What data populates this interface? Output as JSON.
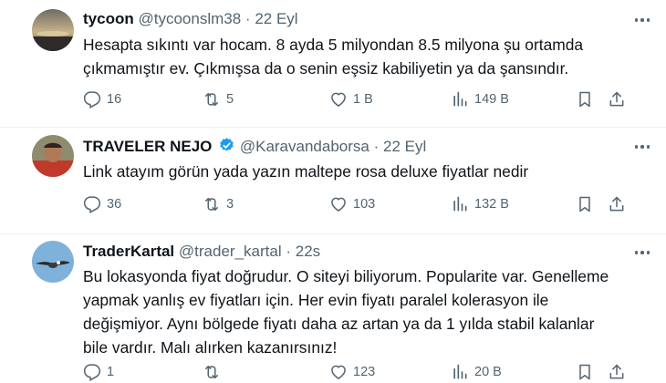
{
  "colors": {
    "text": "#0f1419",
    "muted": "#536471",
    "verified": "#1d9bf0",
    "divider": "#eff3f4"
  },
  "tweets": [
    {
      "name": "tycoon",
      "handle": "@tycoonslm38",
      "dot": "·",
      "time": "22 Eyl",
      "verified": false,
      "lines": [
        "Hesapta sıkıntı var hocam. 8 ayda 5 milyondan 8.5 milyona şu ortamda",
        "çıkmamıştır ev. Çıkmışsa da o senin eşsiz kabiliyetin ya da şansındır."
      ],
      "replies": "16",
      "retweets": "5",
      "likes": "1 B",
      "views": "149 B"
    },
    {
      "name": "TRAVELER NEJO",
      "handle": "@Karavandaborsa",
      "dot": "·",
      "time": "22 Eyl",
      "verified": true,
      "lines": [
        "Link atayım görün yada yazın maltepe rosa deluxe fiyatlar nedir"
      ],
      "replies": "36",
      "retweets": "3",
      "likes": "103",
      "views": "132 B"
    },
    {
      "name": "TraderKartal",
      "handle": "@trader_kartal",
      "dot": "·",
      "time": "22s",
      "verified": false,
      "lines": [
        "Bu lokasyonda fiyat doğrudur. O siteyi biliyorum. Popularite var. Genelleme",
        "yapmak yanlış ev fiyatları için. Her evin fiyatı paralel kolerasyon ile",
        "değişmiyor. Aynı bölgede fiyatı daha az artan ya da 1 yılda stabil kalanlar",
        "bile vardır. Malı alırken kazanırsınız!"
      ],
      "replies": "1",
      "retweets": "",
      "likes": "123",
      "views": "20 B"
    }
  ]
}
